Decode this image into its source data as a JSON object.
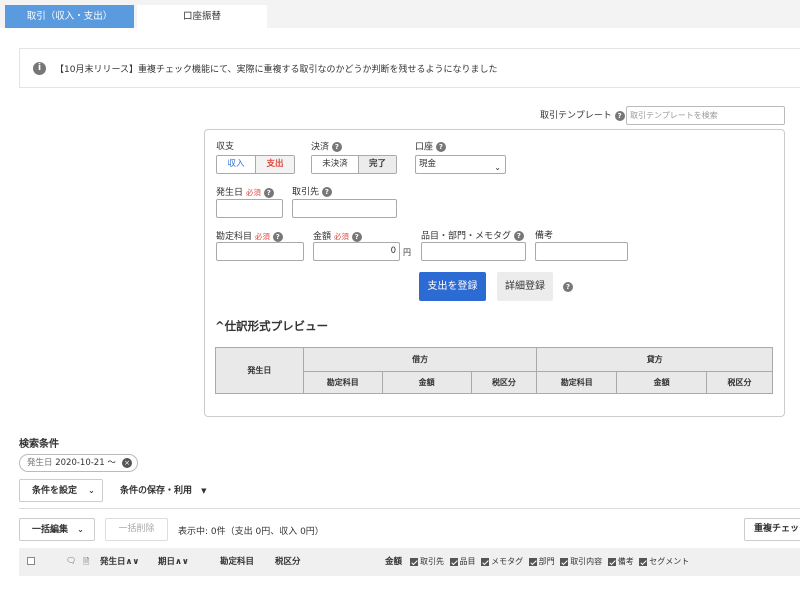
{
  "tabs": [
    {
      "label": "取引（収入・支出）"
    },
    {
      "label": "口座振替"
    }
  ],
  "notice": {
    "text": "【10月末リリース】重複チェック機能にて、実際に重複する取引なのかどうか判断を残せるようになりました"
  },
  "template": {
    "label": "取引テンプレート",
    "placeholder": "取引テンプレートを検索"
  },
  "form": {
    "income_expense": {
      "label": "収支",
      "options": [
        "収入",
        "支出"
      ],
      "selected": "支出"
    },
    "settlement": {
      "label": "決済",
      "options": [
        "未決済",
        "完了"
      ],
      "selected": "完了"
    },
    "account": {
      "label": "口座",
      "value": "現金"
    },
    "date": {
      "label": "発生日",
      "required": "必須"
    },
    "partner": {
      "label": "取引先"
    },
    "account_item": {
      "label": "勘定科目",
      "required": "必須"
    },
    "amount": {
      "label": "金額",
      "required": "必須",
      "value": "0",
      "unit": "円"
    },
    "tags": {
      "label": "品目・部門・メモタグ"
    },
    "memo": {
      "label": "備考"
    },
    "submit_label": "支出を登録",
    "detail_label": "詳細登録"
  },
  "preview": {
    "title": "仕訳形式プレビュー",
    "date_header": "発生日",
    "debit": "借方",
    "credit": "貸方",
    "sub_headers": [
      "勘定科目",
      "金額",
      "税区分"
    ]
  },
  "search": {
    "title": "検索条件",
    "chip_label": "発生日",
    "chip_value": "2020-10-21 〜",
    "set_condition": "条件を設定",
    "save_condition": "条件の保存・利用"
  },
  "list": {
    "bulk_edit": "一括編集",
    "bulk_delete": "一括削除",
    "summary": "表示中: 0件（支出 0円、収入 0円）",
    "duplicate_check": "重複チェック",
    "columns": {
      "date": "発生日",
      "due": "期日",
      "account_item": "勘定科目",
      "tax": "税区分",
      "amount": "金額"
    },
    "toggles": [
      "取引先",
      "品目",
      "メモタグ",
      "部門",
      "取引内容",
      "備考",
      "セグメント"
    ]
  },
  "colors": {
    "tab_active": "#5a9be0",
    "primary_button": "#2d6bd4",
    "required": "#e0463c"
  }
}
